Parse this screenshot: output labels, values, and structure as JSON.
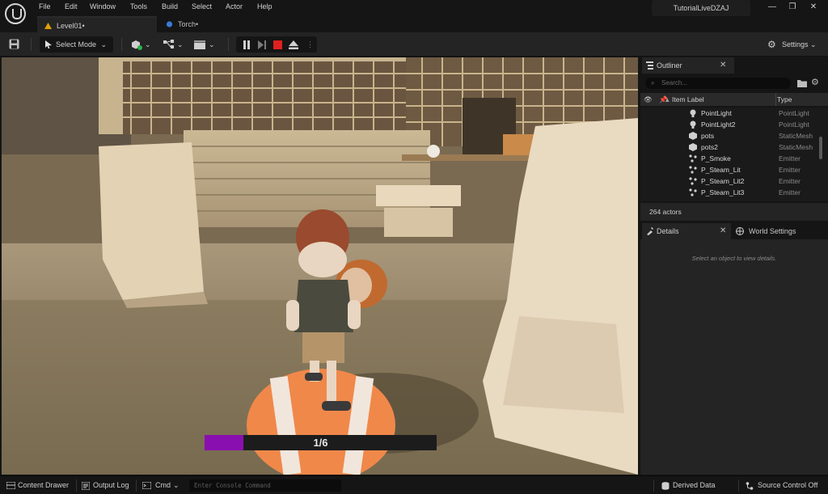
{
  "menu": [
    "File",
    "Edit",
    "Window",
    "Tools",
    "Build",
    "Select",
    "Actor",
    "Help"
  ],
  "project_name": "TutorialLiveDZAJ",
  "tabs": [
    {
      "label": "Level01•",
      "icon": "level-icon"
    },
    {
      "label": "Torch•",
      "icon": "blueprint-icon"
    }
  ],
  "toolbar": {
    "select_mode_label": "Select Mode",
    "settings_label": "Settings"
  },
  "viewport": {
    "progress_text": "1/6",
    "progress_fraction": 0.167
  },
  "outliner": {
    "title": "Outliner",
    "search_placeholder": "Search...",
    "col_label": "Item Label",
    "col_type": "Type",
    "rows": [
      {
        "label": "PointLight",
        "type": "PointLight",
        "icon": "bulb-icon"
      },
      {
        "label": "PointLight2",
        "type": "PointLight",
        "icon": "bulb-icon"
      },
      {
        "label": "pots",
        "type": "StaticMesh",
        "icon": "mesh-icon"
      },
      {
        "label": "pots2",
        "type": "StaticMesh",
        "icon": "mesh-icon"
      },
      {
        "label": "P_Smoke",
        "type": "Emitter",
        "icon": "emitter-icon"
      },
      {
        "label": "P_Steam_Lit",
        "type": "Emitter",
        "icon": "emitter-icon"
      },
      {
        "label": "P_Steam_Lit2",
        "type": "Emitter",
        "icon": "emitter-icon"
      },
      {
        "label": "P_Steam_Lit3",
        "type": "Emitter",
        "icon": "emitter-icon"
      }
    ],
    "actor_count": "264 actors"
  },
  "details": {
    "title": "Details",
    "world_settings": "World Settings",
    "hint": "Select an object to view details."
  },
  "statusbar": {
    "content_drawer": "Content Drawer",
    "output_log": "Output Log",
    "cmd": "Cmd",
    "console_placeholder": "Enter Console Command",
    "derived_data": "Derived Data",
    "source_control": "Source Control Off"
  },
  "colors": {
    "progress_fill": "#8a0fb0",
    "stop_button": "#e02020"
  }
}
